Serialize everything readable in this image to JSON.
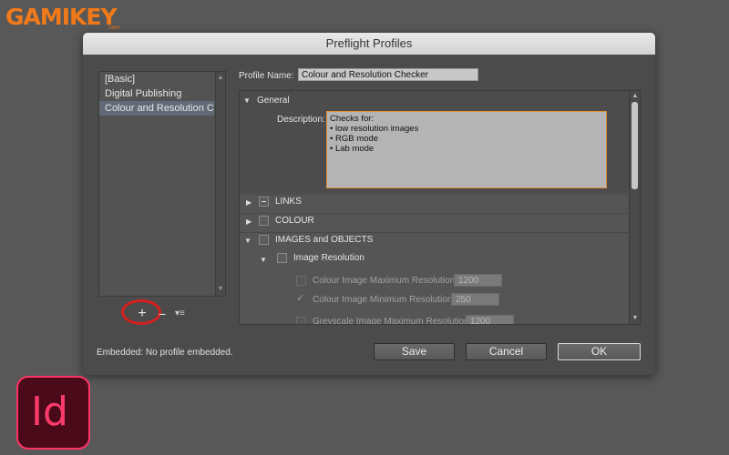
{
  "watermark": {
    "brand": "GAMIKEY",
    "suffix": ".com"
  },
  "dialog": {
    "title": "Preflight Profiles",
    "profiles": [
      "[Basic]",
      "Digital Publishing",
      "Colour and Resolution Chec"
    ],
    "selected_profile_index": 2,
    "list_buttons": {
      "add": "+",
      "remove": "−",
      "menu": "▾≡"
    },
    "embedded_status": "Embedded:  No profile embedded.",
    "profile_name_label": "Profile Name:",
    "profile_name_value": "Colour and Resolution Checker",
    "general": {
      "label": "General",
      "description_label": "Description:",
      "description_lines": [
        "Checks for:",
        "• low resolution images",
        "• RGB mode",
        "• Lab mode"
      ]
    },
    "categories": {
      "links": "LINKS",
      "colour": "COLOUR",
      "images_objects": "IMAGES and OBJECTS",
      "image_resolution": "Image Resolution"
    },
    "resolution_rows": [
      {
        "label": "Colour Image Maximum Resolution:",
        "value": "1200",
        "checked": false
      },
      {
        "label": "Colour Image Minimum Resolution:",
        "value": "250",
        "checked": true
      },
      {
        "label": "Greyscale Image Maximum Resolution:",
        "value": "1200",
        "checked": false
      }
    ],
    "buttons": {
      "save": "Save",
      "cancel": "Cancel",
      "ok": "OK"
    }
  },
  "app_badge": {
    "text": "Id"
  },
  "colors": {
    "brand_orange": "#f07a1a",
    "indesign_pink": "#ff3366",
    "highlight_red": "#d51f1f"
  }
}
